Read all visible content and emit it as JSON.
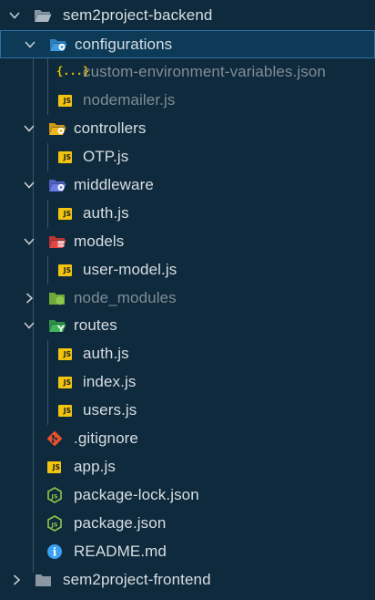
{
  "explorer": {
    "root_label": "sem2project-backend",
    "configurations_label": "configurations",
    "custom_env_label": "custom-environment-variables.json",
    "nodemailer_label": "nodemailer.js",
    "controllers_label": "controllers",
    "otp_label": "OTP.js",
    "middleware_label": "middleware",
    "middleware_auth_label": "auth.js",
    "models_label": "models",
    "user_model_label": "user-model.js",
    "node_modules_label": "node_modules",
    "routes_label": "routes",
    "routes_auth_label": "auth.js",
    "routes_index_label": "index.js",
    "routes_users_label": "users.js",
    "gitignore_label": ".gitignore",
    "app_label": "app.js",
    "package_lock_label": "package-lock.json",
    "package_label": "package.json",
    "readme_label": "README.md",
    "frontend_label": "sem2project-frontend"
  },
  "icons": {
    "js_text": "JS",
    "json_text": "{...}",
    "node_text": "JS",
    "info_text": "i"
  },
  "colors": {
    "background": "#0f2a3c",
    "selected_background": "#0c3a57",
    "selected_border": "#2e6fa0",
    "text": "#d7dee4",
    "dimmed_text": "#7f8d98",
    "js_yellow": "#f1c40f",
    "node_green": "#8cc84b",
    "git_orange": "#e8512d",
    "info_blue": "#3aa0f3"
  }
}
